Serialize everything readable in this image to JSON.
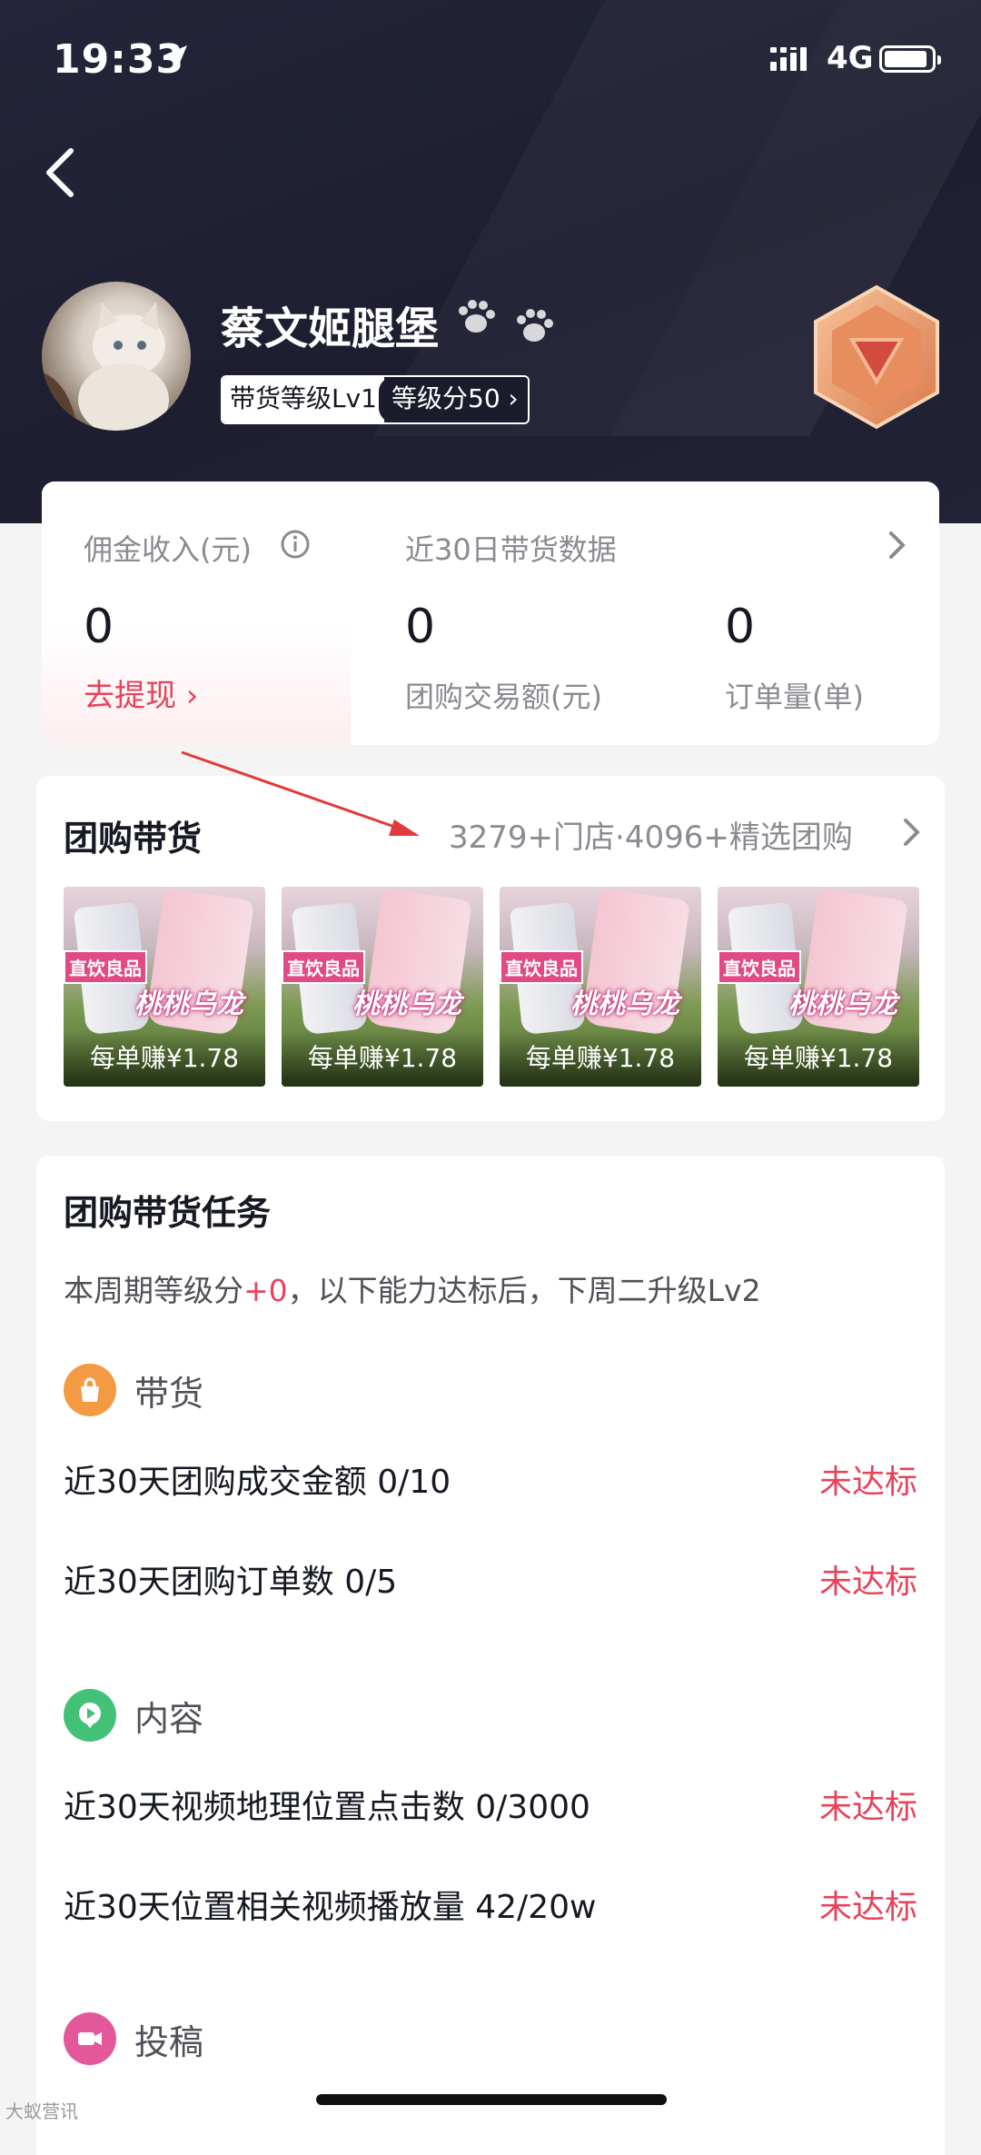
{
  "status_bar": {
    "time": "19:33",
    "network": "4G"
  },
  "profile": {
    "name": "蔡文姬腿堡",
    "level_label": "带货等级Lv1",
    "level_score": "等级分50"
  },
  "stats": {
    "commission_label": "佣金收入(元)",
    "commission_value": "0",
    "withdraw_link": "去提现",
    "recent_label": "近30日带货数据",
    "group_amount_value": "0",
    "group_amount_label": "团购交易额(元)",
    "orders_value": "0",
    "orders_label": "订单量(单)"
  },
  "group_buy": {
    "title": "团购带货",
    "summary": "3279+门店·4096+精选团购",
    "items": [
      {
        "tag1": "直饮良品",
        "tag2": "桃桃乌龙",
        "earn": "每单赚¥1.78"
      },
      {
        "tag1": "直饮良品",
        "tag2": "桃桃乌龙",
        "earn": "每单赚¥1.78"
      },
      {
        "tag1": "直饮良品",
        "tag2": "桃桃乌龙",
        "earn": "每单赚¥1.78"
      },
      {
        "tag1": "直饮良品",
        "tag2": "桃桃乌龙",
        "earn": "每单赚¥1.78"
      }
    ]
  },
  "tasks": {
    "title": "团购带货任务",
    "desc_prefix": "本周期等级分",
    "desc_plus": "+0",
    "desc_suffix": "，以下能力达标后，下周二升级Lv2",
    "categories": [
      {
        "label": "带货",
        "icon": "shopping-bag-icon",
        "color": "#f39a43"
      },
      {
        "label": "内容",
        "icon": "play-icon",
        "color": "#43c177"
      },
      {
        "label": "投稿",
        "icon": "video-camera-icon",
        "color": "#e3589b"
      }
    ],
    "rows": [
      {
        "label": "近30天团购成交金额 0/10",
        "status": "未达标"
      },
      {
        "label": "近30天团购订单数 0/5",
        "status": "未达标"
      },
      {
        "label": "近30天视频地理位置点击数 0/3000",
        "status": "未达标"
      },
      {
        "label": "近30天位置相关视频播放量 42/20w",
        "status": "未达标"
      }
    ]
  },
  "watermark": "大蚁营讯",
  "colors": {
    "accent_red": "#e8435a",
    "header_bg": "#1f2033"
  }
}
